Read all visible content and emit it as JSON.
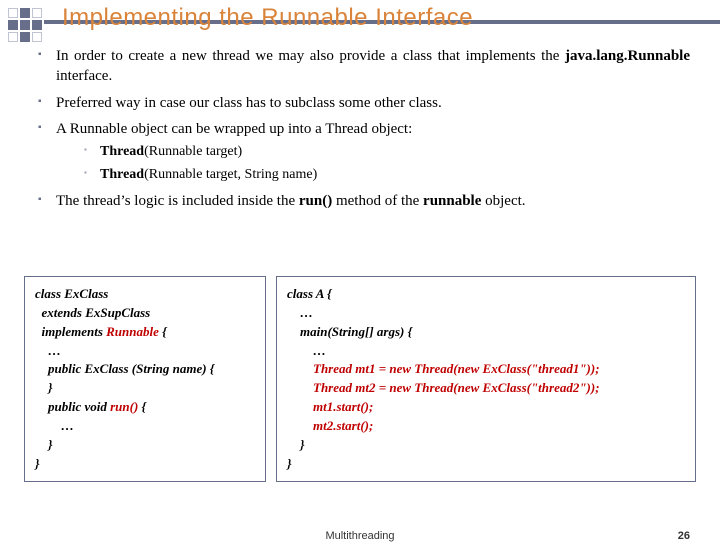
{
  "title": "Implementing the Runnable Interface",
  "bullets": {
    "b1a": "In order to create a new thread we may also provide a class that implements the ",
    "b1b": "java.lang.Runnable",
    "b1c": " interface.",
    "b2": "Preferred way in case our class has to subclass some other class.",
    "b3": "A Runnable object can be wrapped up into a Thread object:",
    "s1a": "Thread",
    "s1b": "(Runnable target)",
    "s2a": "Thread",
    "s2b": "(Runnable target, String name)",
    "b4a": "The thread’s logic is included inside the ",
    "b4b": "run()",
    "b4c": " method of the ",
    "b4d": "runnable",
    "b4e": " object."
  },
  "code_left": {
    "l1": "class ExClass",
    "l2": "  extends ExSupClass",
    "l3a": "  implements ",
    "l3b": "Runnable",
    "l3c": " {",
    "l4": "    …",
    "l5": "    public ExClass (String name) {",
    "l6": "    }",
    "l7a": "    public void ",
    "l7b": "run()",
    "l7c": " {",
    "l8": "        …",
    "l9": "    }",
    "l10": "}"
  },
  "code_right": {
    "l1": "class A {",
    "l2": "    …",
    "l3": "    main(String[] args) {",
    "l4": "        …",
    "l5": "        Thread mt1 = new Thread(new ExClass(\"thread1\"));",
    "l6": "        Thread mt2 = new Thread(new ExClass(\"thread2\"));",
    "l7": "        mt1.start();",
    "l8": "        mt2.start();",
    "l9": "    }",
    "l10": "}"
  },
  "footer": {
    "label": "Multithreading",
    "page": "26"
  }
}
